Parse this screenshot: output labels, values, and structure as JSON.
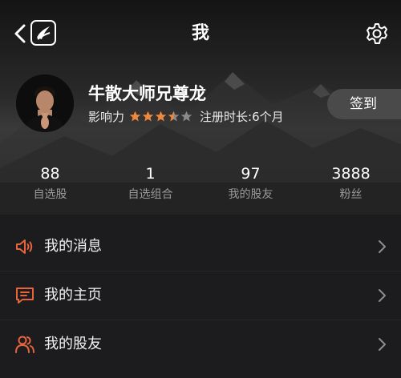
{
  "header": {
    "title": "我"
  },
  "profile": {
    "name": "牛散大师兄尊龙",
    "influence_label": "影响力",
    "rating": 3.5,
    "rating_max": 5,
    "registered_text": "注册时长:6个月",
    "checkin_label": "签到"
  },
  "stats": [
    {
      "value": "88",
      "label": "自选股"
    },
    {
      "value": "1",
      "label": "自选组合"
    },
    {
      "value": "97",
      "label": "我的股友"
    },
    {
      "value": "3888",
      "label": "粉丝"
    }
  ],
  "menu": [
    {
      "label": "我的消息",
      "icon": "speaker-icon"
    },
    {
      "label": "我的主页",
      "icon": "message-icon"
    },
    {
      "label": "我的股友",
      "icon": "friends-icon"
    }
  ],
  "colors": {
    "accent": "#e8643c",
    "star": "#f0883e"
  }
}
